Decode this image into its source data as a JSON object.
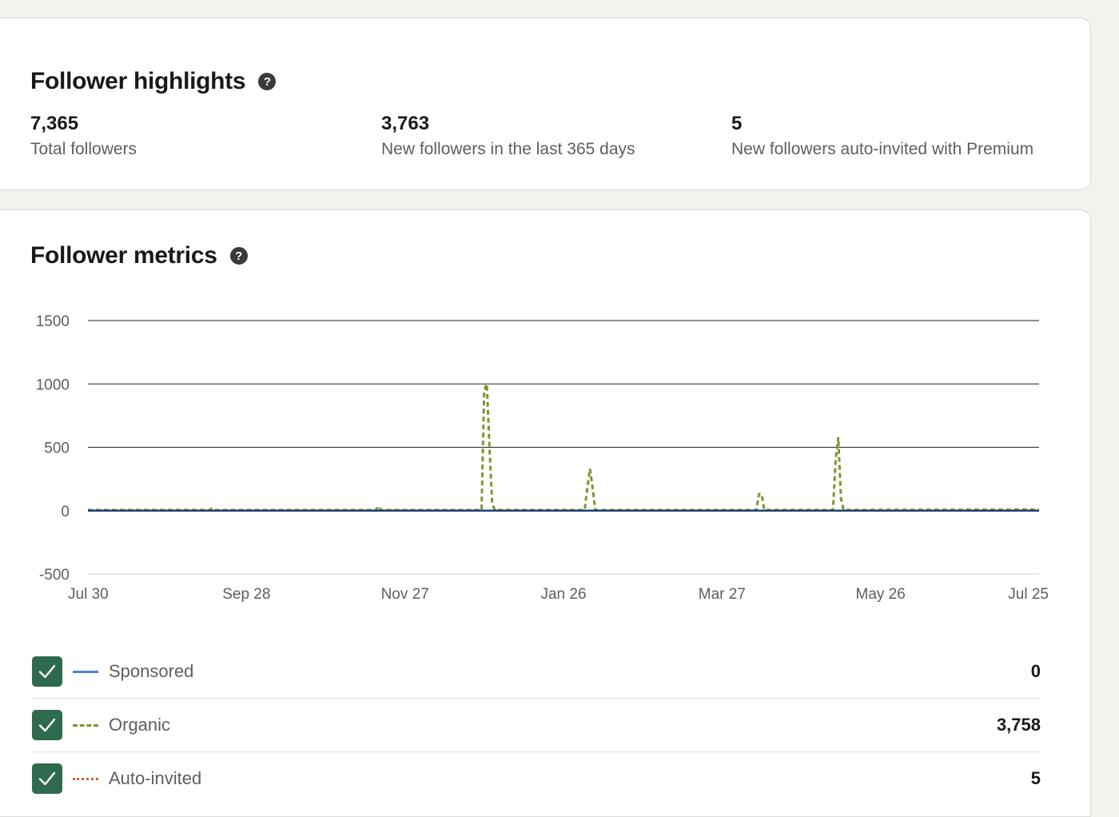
{
  "highlights": {
    "title": "Follower highlights",
    "help_glyph": "?",
    "stats": [
      {
        "value": "7,365",
        "label": "Total followers"
      },
      {
        "value": "3,763",
        "label": "New followers in the last 365 days"
      },
      {
        "value": "5",
        "label": "New followers auto-invited with Premium"
      }
    ]
  },
  "metrics": {
    "title": "Follower metrics",
    "help_glyph": "?",
    "legend": [
      {
        "name": "Sponsored",
        "value": "0",
        "checked": true,
        "color": "#4a86d6",
        "style": "solid"
      },
      {
        "name": "Organic",
        "value": "3,758",
        "checked": true,
        "color": "#7e952f",
        "style": "dashed"
      },
      {
        "name": "Auto-invited",
        "value": "5",
        "checked": true,
        "color": "#c2643f",
        "style": "dotted"
      }
    ]
  },
  "chart_data": {
    "type": "line",
    "y_ticks": [
      1500,
      1000,
      500,
      0,
      -500
    ],
    "ylim": [
      -500,
      1500
    ],
    "x_ticks": [
      "Jul 30",
      "Sep 28",
      "Nov 27",
      "Jan 26",
      "Mar 27",
      "May 26",
      "Jul 25"
    ],
    "xlim": [
      0,
      360
    ],
    "grid": true,
    "series": [
      {
        "name": "Sponsored",
        "color": "#4a86d6",
        "style": "solid",
        "x": [
          0,
          360
        ],
        "y": [
          0,
          0
        ]
      },
      {
        "name": "Organic",
        "color": "#7e952f",
        "style": "dashed",
        "x": [
          0,
          46,
          47,
          48,
          109,
          110,
          111,
          149,
          150,
          151,
          152,
          153,
          154,
          188,
          189,
          190,
          191,
          192,
          253,
          254,
          255,
          256,
          282,
          283,
          284,
          285,
          286,
          360
        ],
        "y": [
          5,
          5,
          20,
          5,
          5,
          35,
          5,
          5,
          950,
          1000,
          500,
          60,
          5,
          5,
          180,
          330,
          180,
          5,
          5,
          130,
          130,
          5,
          5,
          400,
          580,
          100,
          5,
          8
        ]
      },
      {
        "name": "Auto-invited",
        "color": "#c2643f",
        "style": "dotted",
        "x": [
          0,
          360
        ],
        "y": [
          0,
          0
        ]
      }
    ]
  }
}
